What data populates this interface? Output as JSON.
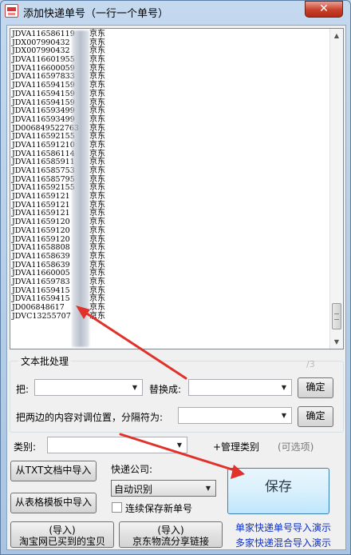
{
  "window": {
    "title": "添加快递单号（一行一个单号）",
    "close_label": "✕"
  },
  "list": {
    "items": [
      {
        "number": "JDVA116586119",
        "carrier": "京东"
      },
      {
        "number": "JDX007990432",
        "carrier": "京东"
      },
      {
        "number": "JDX007990432",
        "carrier": "京东"
      },
      {
        "number": "JDVA116601955",
        "carrier": "京东"
      },
      {
        "number": "JDVA116600059",
        "carrier": "京东"
      },
      {
        "number": "JDVA116597833",
        "carrier": "京东"
      },
      {
        "number": "JDVA116594159",
        "carrier": "京东"
      },
      {
        "number": "JDVA116594159",
        "carrier": "京东"
      },
      {
        "number": "JDVA116594159",
        "carrier": "京东"
      },
      {
        "number": "JDVA116593499",
        "carrier": "京东"
      },
      {
        "number": "JDVA116593499",
        "carrier": "京东"
      },
      {
        "number": "JD006849522763",
        "carrier": "京东"
      },
      {
        "number": "JDVA116592155",
        "carrier": "京东"
      },
      {
        "number": "JDVA116591210",
        "carrier": "京东"
      },
      {
        "number": "JDVA116586114",
        "carrier": "京东"
      },
      {
        "number": "JDVA116585911",
        "carrier": "京东"
      },
      {
        "number": "JDVA116585753",
        "carrier": "京东"
      },
      {
        "number": "JDVA116585795",
        "carrier": "京东"
      },
      {
        "number": "JDVA116592155",
        "carrier": "京东"
      },
      {
        "number": "JDVA11659121",
        "carrier": "京东"
      },
      {
        "number": "JDVA11659121",
        "carrier": "京东"
      },
      {
        "number": "JDVA11659121",
        "carrier": "京东"
      },
      {
        "number": "JDVA11659120",
        "carrier": "京东"
      },
      {
        "number": "JDVA11659120",
        "carrier": "京东"
      },
      {
        "number": "JDVA11659120",
        "carrier": "京东"
      },
      {
        "number": "JDVA11658808",
        "carrier": "京东"
      },
      {
        "number": "JDVA11658639",
        "carrier": "京东"
      },
      {
        "number": "JDVA11658639",
        "carrier": "京东"
      },
      {
        "number": "JDVA11660005",
        "carrier": "京东"
      },
      {
        "number": "JDVA11659783",
        "carrier": "京东"
      },
      {
        "number": "JDVA11659415",
        "carrier": "京东"
      },
      {
        "number": "JDVA11659415",
        "carrier": "京东"
      },
      {
        "number": "JD006848617",
        "carrier": "京东"
      },
      {
        "number": "JDVC13255707",
        "carrier": "京东"
      }
    ]
  },
  "batch": {
    "group_title": "文本批处理",
    "from_label": "把:",
    "replace_label": "替换成:",
    "confirm_label": "确定",
    "swap_label": "把两边的内容对调位置，分隔符为:",
    "swap_confirm_label": "确定",
    "watermark": "/3"
  },
  "category": {
    "label": "类别:",
    "manage_label": "+管理类别",
    "optional_label": "(可选项)"
  },
  "import": {
    "txt_label": "从TXT文档中导入",
    "table_label": "从表格模板中导入",
    "taobao_line1": "(导入)",
    "taobao_line2": "淘宝网已买到的宝贝",
    "jd_line1": "(导入)",
    "jd_line2": "京东物流分享链接"
  },
  "courier": {
    "label": "快递公司:",
    "selected": "自动识别",
    "continuous_label": "连续保存新单号"
  },
  "save": {
    "label": "保存"
  },
  "links": {
    "single_demo": "单家快递单号导入演示",
    "multi_demo": "多家快递混合导入演示"
  },
  "colors": {
    "annotation_arrow": "#e0322a",
    "link": "#1030c0",
    "save_border": "#3c7fb1"
  }
}
